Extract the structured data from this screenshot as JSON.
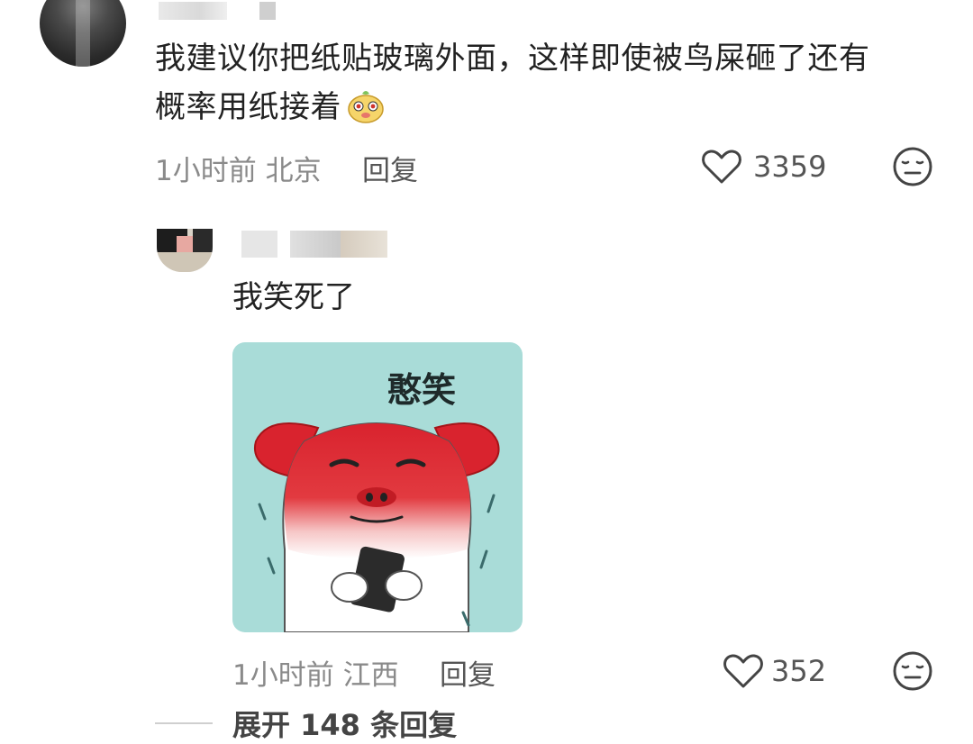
{
  "top_comment": {
    "text_line1": "我建议你把纸贴玻璃外面，这样即使被鸟屎砸了还有",
    "text_line2": "概率用纸接着",
    "time": "1小时前",
    "location": "北京",
    "reply_label": "回复",
    "likes": "3359"
  },
  "reply_comment": {
    "text": "我笑死了",
    "sticker_caption": "憨笑",
    "time": "1小时前",
    "location": "江西",
    "reply_label": "回复",
    "likes": "352"
  },
  "expand": {
    "label": "展开 148 条回复"
  },
  "icons": {
    "like": "heart-outline-icon",
    "dislike": "meh-face-icon",
    "emoji": "cute-face-emoji"
  },
  "colors": {
    "text": "#222222",
    "meta": "#8a8a8a",
    "sticker_bg": "#a9dcd8",
    "sticker_red": "#d9232e"
  }
}
